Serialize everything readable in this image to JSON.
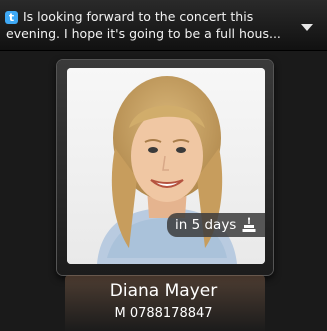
{
  "status": {
    "icon": "twitter-icon",
    "text": "Is looking forward to the concert this evening. I hope it's going to be a full hous...",
    "expand_icon": "chevron-down-icon"
  },
  "contact": {
    "name": "Diana Mayer",
    "phone": "M 0788178847",
    "badge": {
      "text": "in 5 days",
      "icon": "birthday-cake-icon"
    }
  },
  "colors": {
    "accent": "#3fa9f5",
    "background": "#1a1a1a"
  }
}
